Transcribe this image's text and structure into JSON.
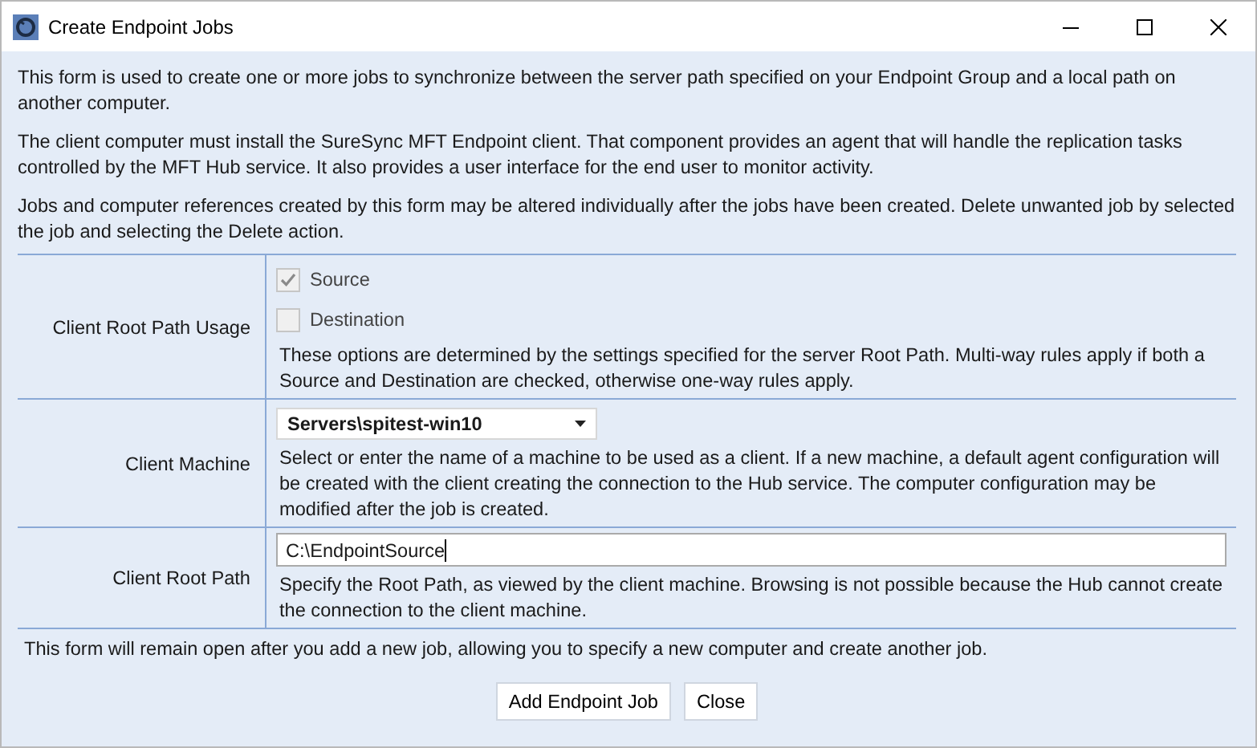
{
  "window": {
    "title": "Create Endpoint Jobs"
  },
  "intro": [
    "This form is used to create one or more jobs to synchronize between the server path specified on your Endpoint Group and a local path on another computer.",
    "The client computer must install the SureSync MFT Endpoint client. That component provides an agent that will handle the replication tasks controlled by the MFT Hub service. It also provides a user interface for the end user to monitor activity.",
    "Jobs and computer references created by this form may be altered individually after the jobs have been created. Delete unwanted job by selected the job and selecting the Delete action."
  ],
  "rows": [
    {
      "kind": "checkboxes",
      "label": "Client Root Path Usage",
      "options": [
        {
          "label": "Source",
          "checked": true,
          "disabled": true
        },
        {
          "label": "Destination",
          "checked": false,
          "disabled": true
        }
      ],
      "help": "These options are determined by the settings specified for the server Root Path. Multi-way rules apply if both a Source and Destination are checked, otherwise one-way rules apply."
    },
    {
      "kind": "dropdown",
      "label": "Client Machine",
      "value": "Servers\\spitest-win10",
      "help": "Select or enter the name of a machine to be used as a client. If a new machine, a default agent configuration will be created with the client creating the connection to the Hub service. The computer configuration may be modified after the job is created."
    },
    {
      "kind": "textbox",
      "label": "Client Root Path",
      "value": "C:\\EndpointSource",
      "help": "Specify the Root Path, as viewed by the client machine. Browsing is not possible because the Hub cannot create the connection to the client machine."
    }
  ],
  "footer_note": "This form will remain open after you add a new job, allowing you to specify a new computer and create another job.",
  "buttons": [
    "Add Endpoint Job",
    "Close"
  ]
}
